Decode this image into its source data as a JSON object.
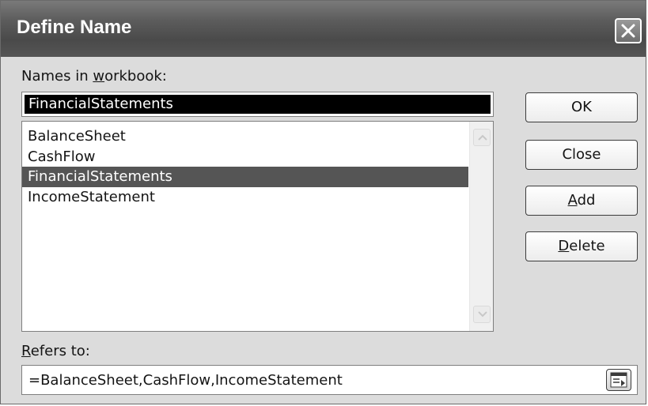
{
  "dialog": {
    "title": "Define Name",
    "close_icon": "close-x-icon"
  },
  "names_label": {
    "before": "Names in ",
    "accel": "w",
    "after": "orkbook:"
  },
  "name_input": {
    "value": "FinancialStatements"
  },
  "names_list": {
    "items": [
      "BalanceSheet",
      "CashFlow",
      "FinancialStatements",
      "IncomeStatement"
    ],
    "selected": "FinancialStatements",
    "scroll_up_icon": "chevron-up-icon",
    "scroll_down_icon": "chevron-down-icon"
  },
  "buttons": {
    "ok": "OK",
    "close": "Close",
    "add_accel": "A",
    "add_rest": "dd",
    "delete_accel": "D",
    "delete_rest": "elete"
  },
  "refers_label": {
    "accel": "R",
    "after": "efers to:"
  },
  "refers_input": {
    "value": "=BalanceSheet,CashFlow,IncomeStatement",
    "collapse_icon": "collapse-dialog-icon"
  },
  "colors": {
    "selection": "#555555",
    "title_bar": "#5c5c5c",
    "dialog_bg": "#dcdcdc"
  }
}
